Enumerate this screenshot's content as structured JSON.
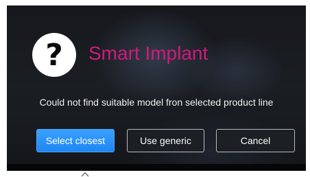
{
  "dialog": {
    "icon": "question-mark-icon",
    "icon_glyph": "?",
    "title": "Smart Implant",
    "message": "Could not find suitable model fron selected product line",
    "buttons": {
      "select_closest": "Select closest",
      "use_generic": "Use generic",
      "cancel": "Cancel"
    }
  },
  "colors": {
    "title": "#d11a7d",
    "primary_button": "#2b93fa",
    "background": "#1b1e23"
  }
}
